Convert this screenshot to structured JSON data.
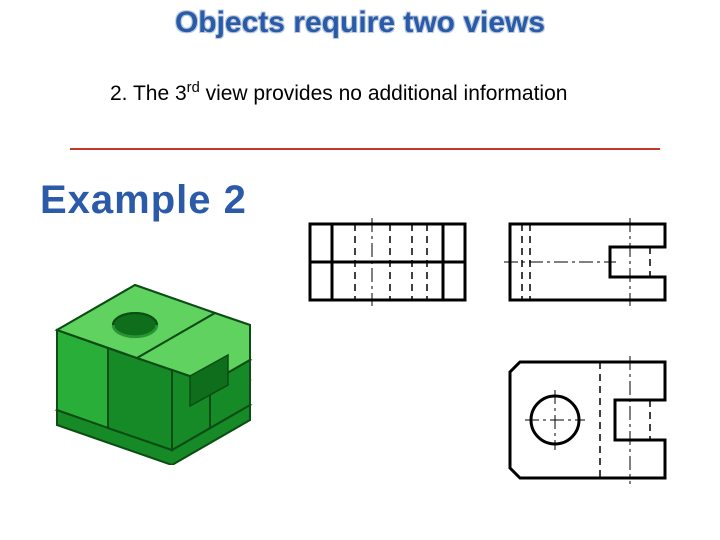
{
  "title": "Objects require two views",
  "subtitle_prefix": "2. The 3",
  "subtitle_sup": "rd",
  "subtitle_suffix": " view provides no additional information",
  "example_label": "Example 2",
  "iso_colors": {
    "light": "#5fd25f",
    "mid": "#2aae3a",
    "dark": "#168a26",
    "edge": "#0b4d14"
  }
}
